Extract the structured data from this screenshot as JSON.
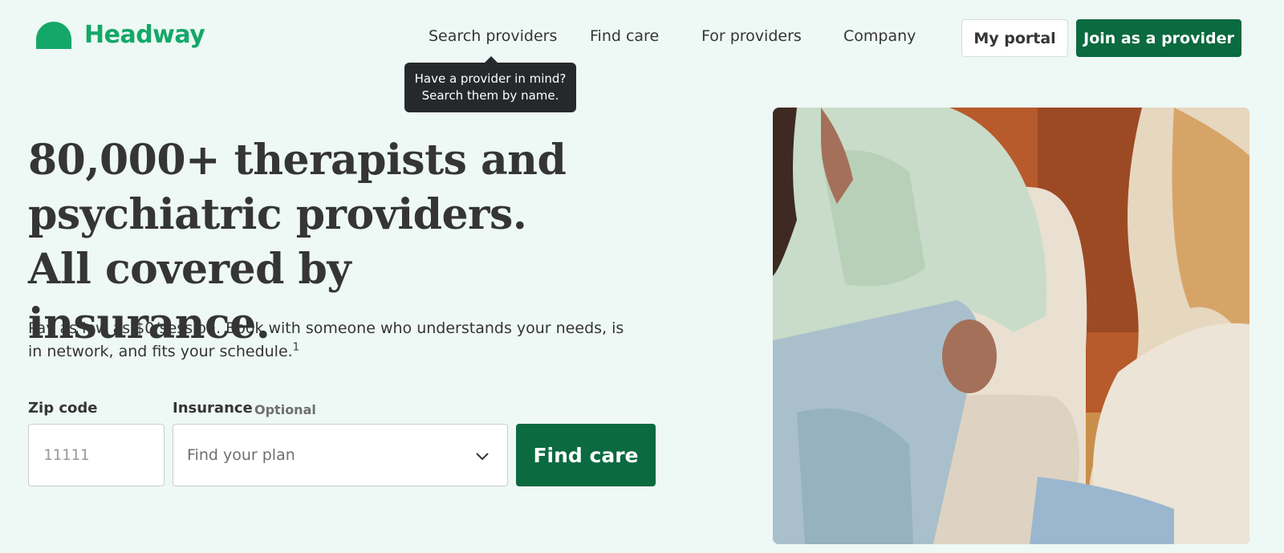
{
  "brand": {
    "name": "Headway",
    "color": "#13a868"
  },
  "nav": {
    "items": [
      {
        "label": "Search providers"
      },
      {
        "label": "Find care"
      },
      {
        "label": "For providers"
      },
      {
        "label": "Company"
      }
    ],
    "portal_label": "My portal",
    "join_label": "Join as a provider"
  },
  "tooltip": {
    "line1": "Have a provider in mind?",
    "line2": "Search them by name."
  },
  "hero": {
    "headline": "80,000+ therapists and psychiatric providers. All covered by insurance.",
    "subtext": "Pay as low as $0/session. Book with someone who understands your needs, is in network, and fits your schedule.",
    "footnote": "1"
  },
  "form": {
    "zip_label": "Zip code",
    "zip_placeholder": "11111",
    "zip_value": "",
    "insurance_label": "Insurance",
    "insurance_optional": "Optional",
    "insurance_placeholder": "Find your plan",
    "submit_label": "Find care"
  },
  "colors": {
    "background": "#eef8f4",
    "primary_button": "#0b6a3f",
    "tooltip_bg": "#26292b"
  }
}
